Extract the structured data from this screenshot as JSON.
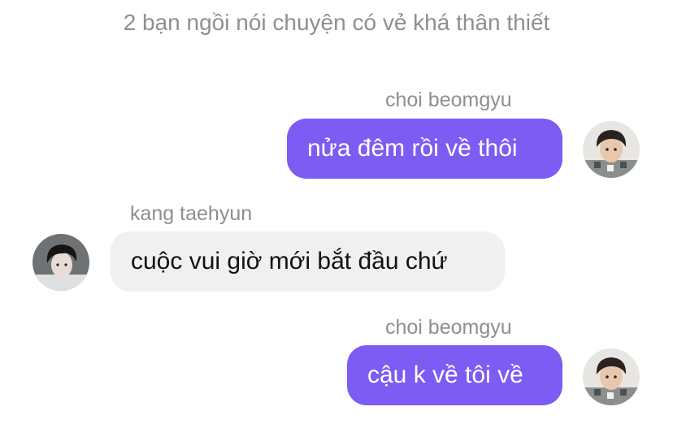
{
  "header": {
    "system_note": "2 bạn ngồi nói chuyện có vẻ khá thân thiết"
  },
  "messages": [
    {
      "sender": "choi beomgyu",
      "text": "nửa đêm rồi về thôi",
      "side": "right",
      "avatar_icon": "beomgyu-avatar-icon"
    },
    {
      "sender": "kang taehyun",
      "text": "cuộc vui giờ mới bắt đầu chứ",
      "side": "left",
      "avatar_icon": "taehyun-avatar-icon"
    },
    {
      "sender": "choi beomgyu",
      "text": "cậu k về tôi về",
      "side": "right",
      "avatar_icon": "beomgyu-avatar-icon"
    }
  ],
  "colors": {
    "outgoing_bubble": "#7c5cf2",
    "incoming_bubble": "#f0f0f0",
    "meta_text": "#8e8e93"
  }
}
